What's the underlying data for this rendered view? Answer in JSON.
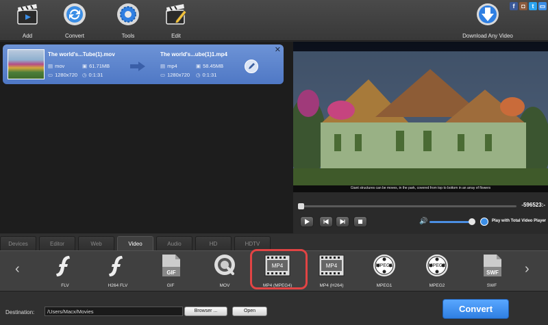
{
  "toolbar": {
    "add_label": "Add",
    "convert_label": "Convert",
    "tools_label": "Tools",
    "edit_label": "Edit",
    "download_label": "Download Any Video",
    "social": [
      "facebook-icon",
      "instagram-icon",
      "twitter-icon",
      "chat-icon"
    ]
  },
  "file": {
    "source": {
      "name": "The world's...Tube(1).mov",
      "format": "mov",
      "size": "61.71MB",
      "resolution": "1280x720",
      "duration": "0:1:31"
    },
    "output": {
      "name": "The world's...ube(1)1.mp4",
      "format": "mp4",
      "size": "58.45MB",
      "resolution": "1280x720",
      "duration": "0:1:31"
    }
  },
  "preview": {
    "caption": "Giant structures can be moves, in the park, covered from top to bottom in an array of flowers"
  },
  "player": {
    "time": "-596523:-",
    "play_with_label": "Play with Total Video Player"
  },
  "tabs": [
    {
      "label": "Devices"
    },
    {
      "label": "Editor"
    },
    {
      "label": "Web"
    },
    {
      "label": "Video"
    },
    {
      "label": "Audio"
    },
    {
      "label": "HD"
    },
    {
      "label": "HDTV"
    }
  ],
  "active_tab": "Video",
  "formats": [
    {
      "label": "FLV",
      "icon": "flash-icon"
    },
    {
      "label": "H264 FLV",
      "icon": "flash-icon"
    },
    {
      "label": "GIF",
      "icon": "gif-icon",
      "badge": "GIF"
    },
    {
      "label": "MOV",
      "icon": "quicktime-icon"
    },
    {
      "label": "MP4 (MPEG4)",
      "icon": "mp4-film-icon",
      "badge": "MP4"
    },
    {
      "label": "MP4 (H264)",
      "icon": "mp4-film-icon",
      "badge": "MP4"
    },
    {
      "label": "MPEG1",
      "icon": "mpeg-reel-icon",
      "badge": "MPEG1"
    },
    {
      "label": "MPEG2",
      "icon": "mpeg-reel-icon",
      "badge": "MPEG2"
    },
    {
      "label": "SWF",
      "icon": "swf-icon",
      "badge": "SWF"
    }
  ],
  "selected_format": "MP4 (MPEG4)",
  "destination": {
    "label": "Destination:",
    "path": "/Users/Macx/Movies",
    "browse_label": "Browser ...",
    "open_label": "Open"
  },
  "convert_button": "Convert",
  "colors": {
    "accent": "#3b8ee6",
    "selection_ring": "#e24444",
    "file_item": "#5a83cc"
  }
}
